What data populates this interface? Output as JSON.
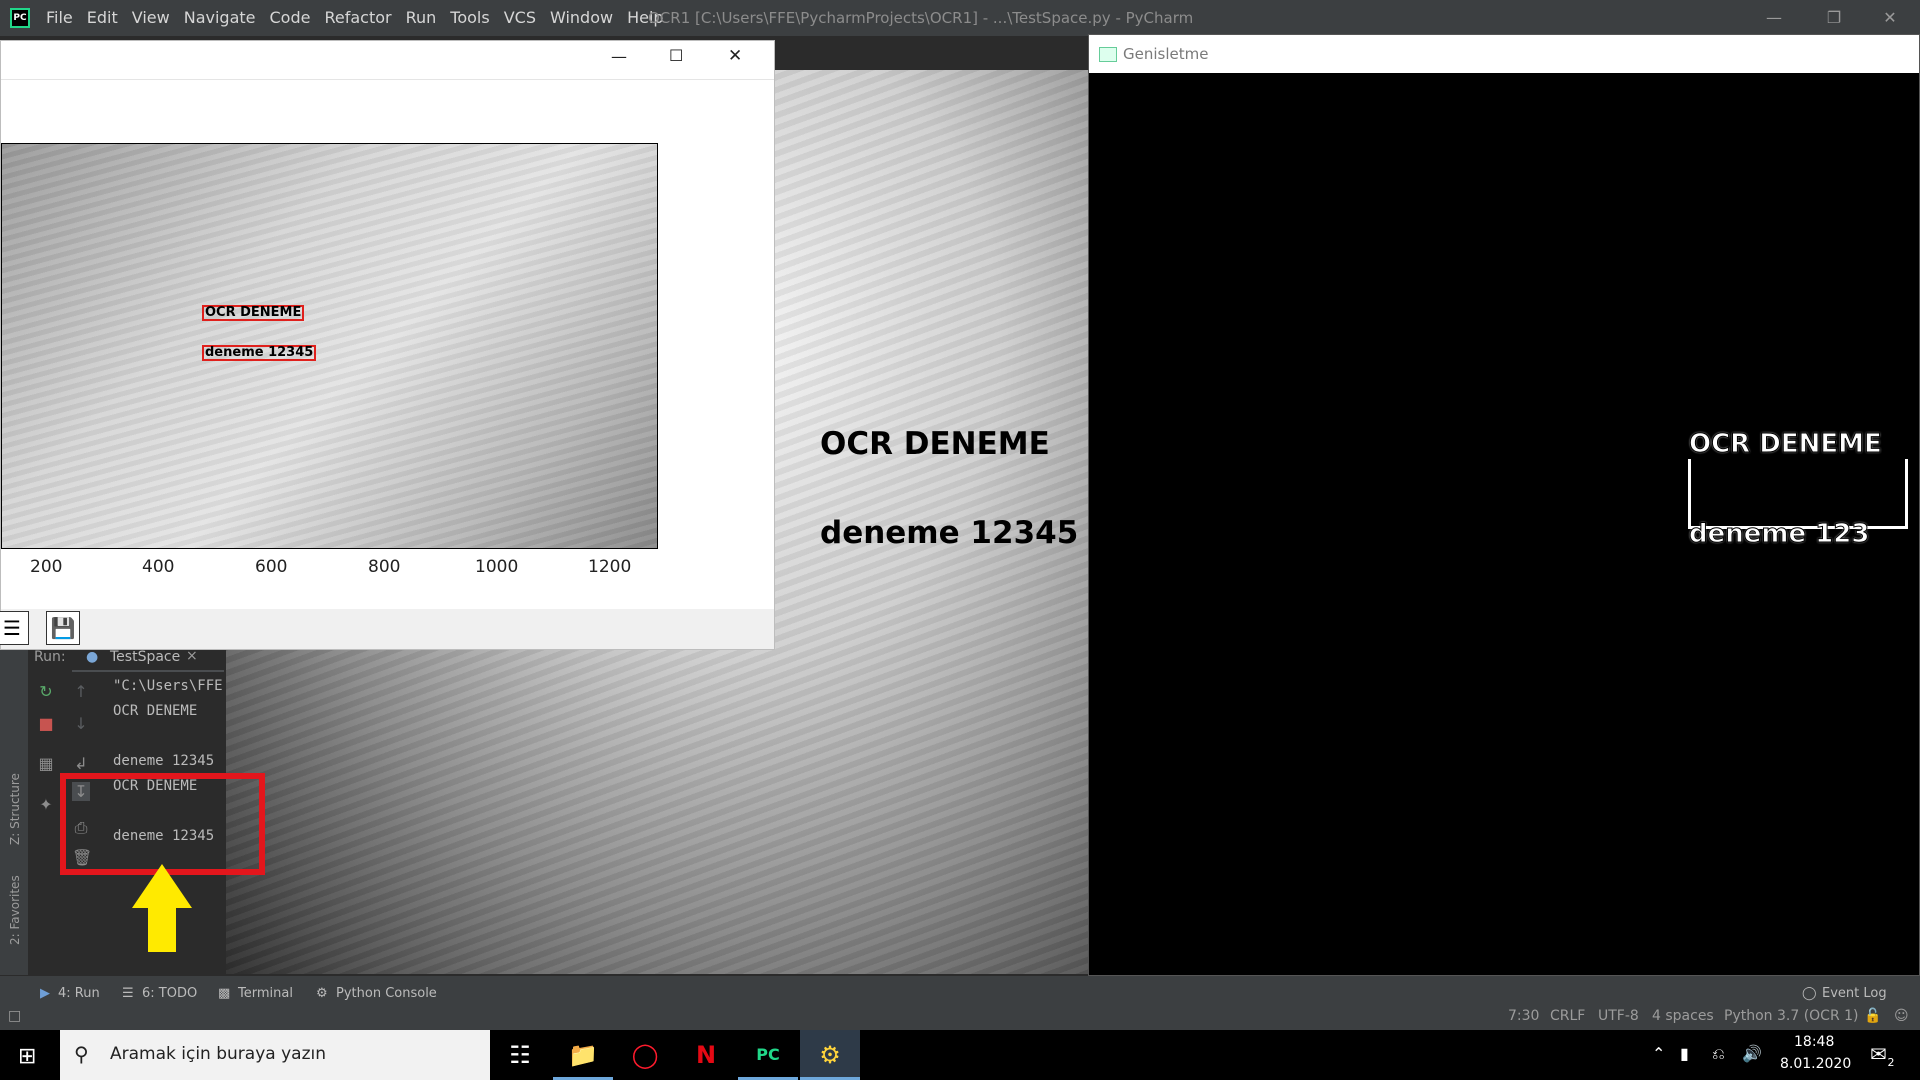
{
  "pycharm": {
    "logo_text": "PC",
    "menu": [
      "File",
      "Edit",
      "View",
      "Navigate",
      "Code",
      "Refactor",
      "Run",
      "Tools",
      "VCS",
      "Window",
      "Help"
    ],
    "title": "OCR1 [C:\\Users\\FFE\\PycharmProjects\\OCR1] - ...\\TestSpace.py - PyCharm"
  },
  "viewer": {
    "line1": "OCR DENEME",
    "line2": "deneme   12345"
  },
  "genisletme": {
    "title": "Genisletme",
    "line1": "OCR DENEME",
    "line2": "deneme   123"
  },
  "plot": {
    "box1": "OCR DENEME",
    "box2": "deneme   12345",
    "xticks": [
      "200",
      "400",
      "600",
      "800",
      "1000",
      "1200"
    ]
  },
  "run": {
    "label": "Run:",
    "tab": "TestSpace",
    "console": [
      "\"C:\\Users\\FFE",
      "OCR DENEME",
      "",
      "deneme 12345",
      "OCR DENEME",
      "",
      "deneme 12345"
    ]
  },
  "left_strip": {
    "structure": "Z: Structure",
    "favorites": "2: Favorites"
  },
  "tool_tabs": {
    "run": "4: Run",
    "todo": "6: TODO",
    "terminal": "Terminal",
    "python_console": "Python Console",
    "event_log": "Event Log"
  },
  "status": {
    "position": "7:30",
    "line_sep": "CRLF",
    "encoding": "UTF-8",
    "indent": "4 spaces",
    "interpreter": "Python 3.7 (OCR 1)"
  },
  "taskbar": {
    "search_placeholder": "Aramak için buraya yazın",
    "time": "18:48",
    "date": "8.01.2020",
    "notif_count": "2"
  },
  "colors": {
    "ide_dark": "#2b2b2b",
    "ide_panel": "#3c3f41",
    "ocr_box": "#e0201c",
    "annotation_red": "#e3161c",
    "annotation_arrow": "#ffea00"
  }
}
